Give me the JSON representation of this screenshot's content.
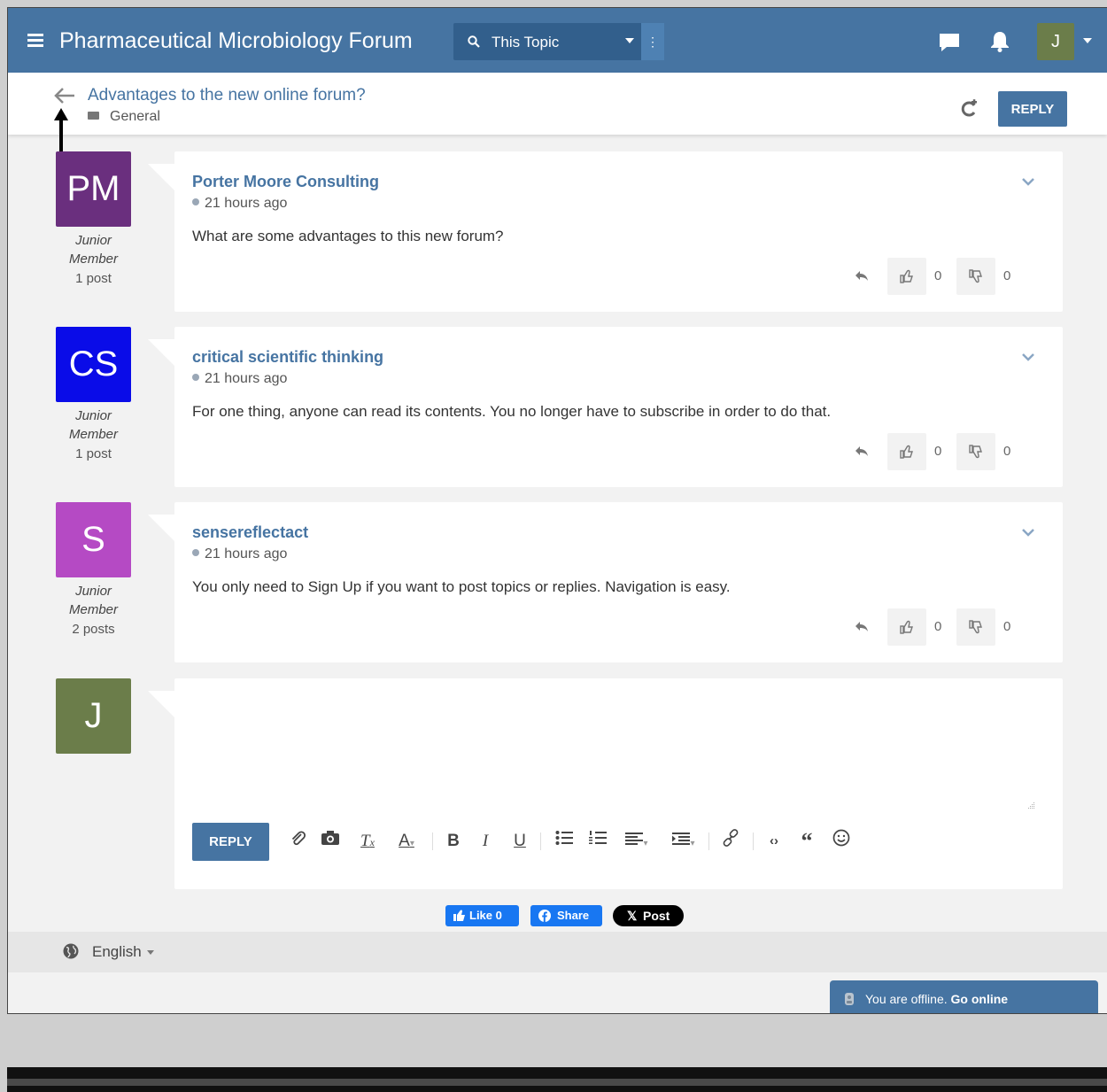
{
  "header": {
    "site_title": "Pharmaceutical Microbiology Forum",
    "search_scope": "This Topic",
    "search_options_label": "⋮",
    "user_initial": "J",
    "user_avatar_color": "#6b7d4a",
    "bar_color": "#4674a2"
  },
  "topic": {
    "title": "Advantages to the new online forum?",
    "category": "General",
    "reply_label": "REPLY"
  },
  "posts": [
    {
      "initials": "PM",
      "avatar_color": "#6a2f7e",
      "author": "Porter Moore Consulting",
      "rank_line1": "Junior",
      "rank_line2": "Member",
      "post_count": "1 post",
      "time": "21 hours ago",
      "content": "What are some advantages to this new forum?",
      "upvotes": "0",
      "downvotes": "0"
    },
    {
      "initials": "CS",
      "avatar_color": "#0a0ce8",
      "author": "critical scientific thinking",
      "rank_line1": "Junior",
      "rank_line2": "Member",
      "post_count": "1 post",
      "time": "21 hours ago",
      "content": "For one thing, anyone can read its contents. You no longer have to subscribe in order to do that.",
      "upvotes": "0",
      "downvotes": "0"
    },
    {
      "initials": "S",
      "avatar_color": "#b54ac4",
      "author": "sensereflectact",
      "rank_line1": "Junior",
      "rank_line2": "Member",
      "post_count": "2 posts",
      "time": "21 hours ago",
      "content": "You only need to Sign Up if you want to post topics or replies. Navigation is easy.",
      "upvotes": "0",
      "downvotes": "0"
    }
  ],
  "composer": {
    "user_initial": "J",
    "avatar_color": "#6b7d4a",
    "reply_label": "REPLY",
    "toolbar_icons": [
      "attach-icon",
      "camera-icon",
      "clear-format-icon",
      "text-color-icon",
      "bold-icon",
      "italic-icon",
      "underline-icon",
      "bullet-list-icon",
      "numbered-list-icon",
      "align-icon",
      "indent-icon",
      "link-icon",
      "code-icon",
      "quote-icon",
      "emoji-icon"
    ]
  },
  "social": {
    "like_label": "Like 0",
    "share_label": "Share",
    "post_label": "Post",
    "x_label": "𝕏"
  },
  "footer": {
    "language": "English"
  },
  "status": {
    "offline_text": "You are offline. ",
    "go_online_label": "Go online"
  }
}
